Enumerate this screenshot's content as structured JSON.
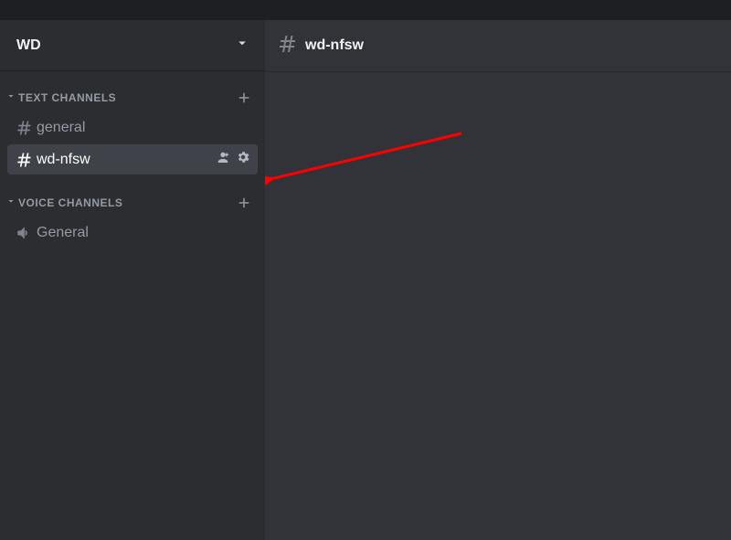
{
  "server": {
    "name": "WD"
  },
  "sidebar": {
    "categories": [
      {
        "label": "TEXT CHANNELS",
        "channels": [
          {
            "name": "general"
          },
          {
            "name": "wd-nfsw"
          }
        ]
      },
      {
        "label": "VOICE CHANNELS",
        "channels": [
          {
            "name": "General"
          }
        ]
      }
    ]
  },
  "current_channel": {
    "name": "wd-nfsw"
  },
  "colors": {
    "sidebar_bg": "#2b2d31",
    "main_bg": "#313338",
    "titlebar_bg": "#1e1f22",
    "text_primary": "#f2f3f5",
    "text_muted": "#949ba4",
    "annotation_arrow": "#ff0000"
  }
}
